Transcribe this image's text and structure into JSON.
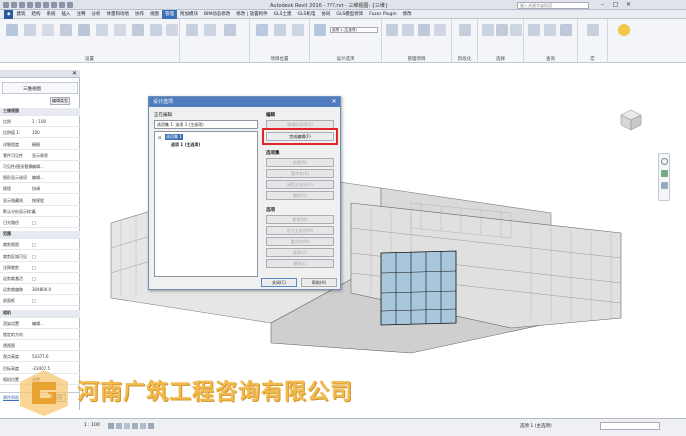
{
  "titlebar": {
    "app_title": "Autodesk Revit 2016 -   ???.rvt - 三维视图: {三维}",
    "search_placeholder": "键入关键字或短语"
  },
  "ribbon": {
    "tabs": [
      "建筑",
      "结构",
      "系统",
      "插入",
      "注释",
      "分析",
      "体量和场地",
      "协作",
      "视图",
      "管理",
      "附加模块",
      "BIM动态修改",
      "修改 | 放置构件",
      "GLS土建",
      "GLS机电",
      "协同",
      "GLS模型修饰",
      "Fuzor Plugin",
      "修改"
    ],
    "active_tab": "管理",
    "groups": [
      "设置",
      "项目位置",
      "设计选项",
      "管理项目",
      "阶段化",
      "选择",
      "查询",
      "宏"
    ],
    "design_option_dropdown": "选项 1 (主选项)"
  },
  "properties": {
    "type_selector": "三维视图",
    "edit_type": "编辑类型",
    "rows": [
      {
        "k": "三维视图",
        "v": "",
        "section": true
      },
      {
        "k": "比例",
        "v": "1 : 100"
      },
      {
        "k": "比例值 1:",
        "v": "100"
      },
      {
        "k": "详细程度",
        "v": "精细"
      },
      {
        "k": "零件可见性",
        "v": "显示原状"
      },
      {
        "k": "可见性/图形替换",
        "v": "编辑..."
      },
      {
        "k": "图形显示选项",
        "v": "编辑..."
      },
      {
        "k": "规程",
        "v": "协调"
      },
      {
        "k": "显示隐藏线",
        "v": "按规程"
      },
      {
        "k": "默认分析显示样式",
        "v": "无"
      },
      {
        "k": "日光路径",
        "v": "□"
      },
      {
        "k": "范围",
        "v": "",
        "section": true
      },
      {
        "k": "裁剪视图",
        "v": "□"
      },
      {
        "k": "裁剪区域可见",
        "v": "□"
      },
      {
        "k": "注释裁剪",
        "v": "□"
      },
      {
        "k": "远剪裁激活",
        "v": "□"
      },
      {
        "k": "远剪裁偏移",
        "v": "304800.0"
      },
      {
        "k": "剖面框",
        "v": "□"
      },
      {
        "k": "相机",
        "v": "",
        "section": true
      },
      {
        "k": "渲染设置",
        "v": "编辑..."
      },
      {
        "k": "锁定的方向",
        "v": ""
      },
      {
        "k": "透视图",
        "v": ""
      },
      {
        "k": "视点高度",
        "v": "54377.6"
      },
      {
        "k": "目标高度",
        "v": "-23407.5"
      },
      {
        "k": "相机位置",
        "v": "调整"
      }
    ],
    "help_link": "属性帮助",
    "apply": "应用"
  },
  "dialog": {
    "title": "设计选项",
    "editing_label": "正在编辑",
    "editing_value": "选项集 1:  选项 1 (主选项)",
    "tree_set": "选项集 1",
    "tree_option": "选项 1 (主选项)",
    "edit_section": "编辑",
    "edit_selected": "编辑所选项(E)",
    "finish_editing": "完成编辑(F)",
    "option_set_section": "选项集",
    "new_set": "新建(N)",
    "rename_set": "重命名(R)",
    "accept_primary": "接受主选项(A)",
    "delete_set": "删除(D)",
    "option_section": "选项",
    "new_option": "新建(W)",
    "make_primary": "设为主选项(M)",
    "rename_option": "重命名(M)",
    "duplicate_option": "复制(U)",
    "delete_option": "删除(L)",
    "close": "关闭(C)",
    "help": "帮助(H)"
  },
  "status": {
    "scale": "1 : 100",
    "design_option": "选项 1 (主选项)"
  },
  "watermark": {
    "company": "河南广筑工程咨询有限公司"
  },
  "colors": {
    "accent": "#3d6fb6",
    "highlight": "#e0262a",
    "watermark": "#f2b23a"
  }
}
